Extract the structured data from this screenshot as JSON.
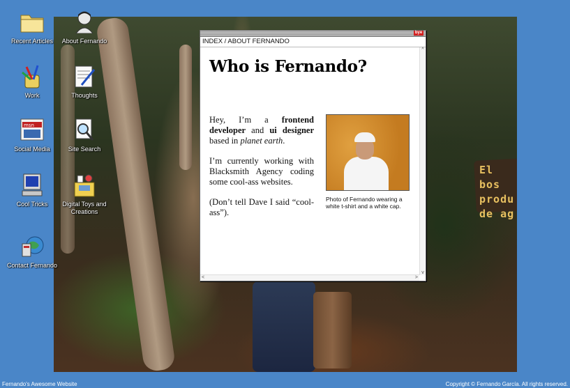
{
  "desktop": {
    "icons": [
      {
        "label": "Recent Articles"
      },
      {
        "label": "About Fernando"
      },
      {
        "label": "Work"
      },
      {
        "label": "Thoughts"
      },
      {
        "label": "Social Media"
      },
      {
        "label": "Site Search"
      },
      {
        "label": "Cool Tricks"
      },
      {
        "label": "Digital Toys and Creations"
      },
      {
        "label": "Contact Fernando"
      }
    ]
  },
  "wallpaper": {
    "sign_lines": [
      "El bos",
      "produ",
      "de ag"
    ]
  },
  "window": {
    "close_label": "bye",
    "breadcrumb": "INDEX / ABOUT FERNANDO",
    "title": "Who is Fernando?",
    "p1": {
      "pre": "Hey, I’m a ",
      "bold1": "frontend developer",
      "mid": " and ",
      "bold2": "ui designer",
      "post": " based in ",
      "italic": "planet earth",
      "end": "."
    },
    "p2": "I’m currently working with Blacksmith Agency coding some cool-ass websites.",
    "p3": "(Don’t tell Dave I said “cool-ass”).",
    "photo_caption": "Photo of Fernando wearing a white t-shirt and a white cap.",
    "scroll": {
      "up": "^",
      "down": "v",
      "left": "<",
      "right": ">"
    }
  },
  "footer": {
    "left": "Fernando's Awesome Website",
    "right": "Copyright © Fernando García. All rights reserved."
  },
  "colors": {
    "desktop_bg": "#4a86c8",
    "close_red": "#d42020"
  }
}
